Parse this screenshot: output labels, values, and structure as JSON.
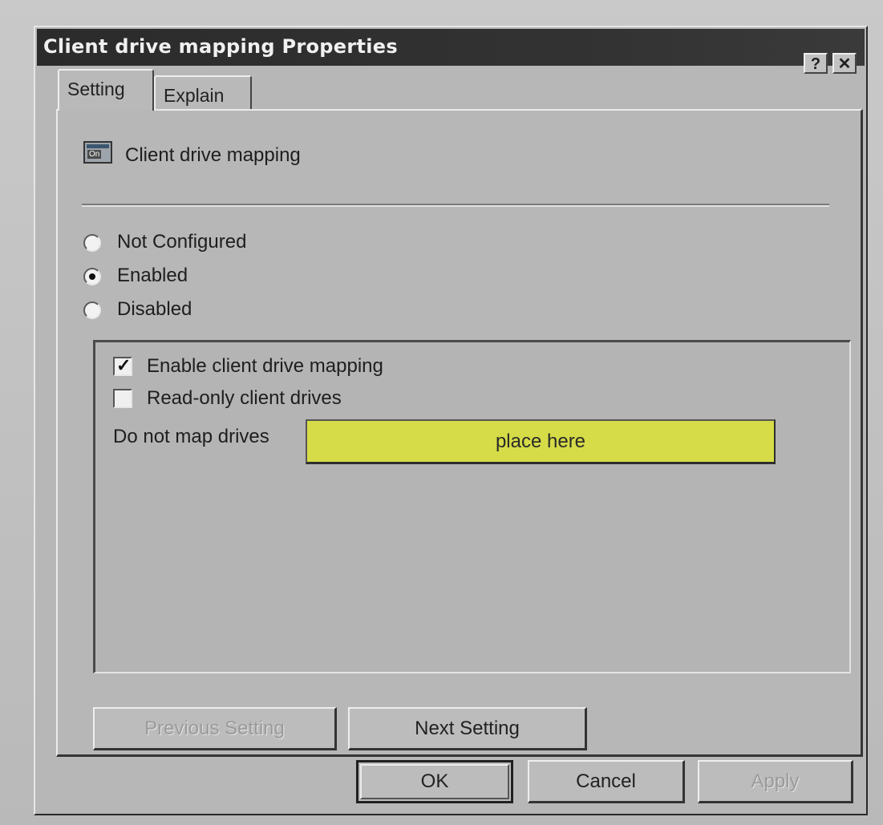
{
  "window": {
    "title": "Client drive mapping Properties",
    "help_symbol": "?",
    "close_symbol": "✕"
  },
  "tabs": [
    {
      "label": "Setting",
      "selected": true
    },
    {
      "label": "Explain",
      "selected": false
    }
  ],
  "policy": {
    "name": "Client drive mapping",
    "icon": "policy-setting-icon"
  },
  "state_options": [
    {
      "label": "Not Configured",
      "checked": false
    },
    {
      "label": "Enabled",
      "checked": true
    },
    {
      "label": "Disabled",
      "checked": false
    }
  ],
  "options": {
    "enable_mapping": {
      "label": "Enable client drive mapping",
      "checked": true
    },
    "read_only": {
      "label": "Read-only client drives",
      "checked": false
    },
    "do_not_map": {
      "label": "Do not map drives",
      "value": "place here",
      "highlight_color": "#d6dc47"
    }
  },
  "buttons": {
    "previous": "Previous Setting",
    "next": "Next Setting",
    "ok": "OK",
    "cancel": "Cancel",
    "apply": "Apply"
  }
}
